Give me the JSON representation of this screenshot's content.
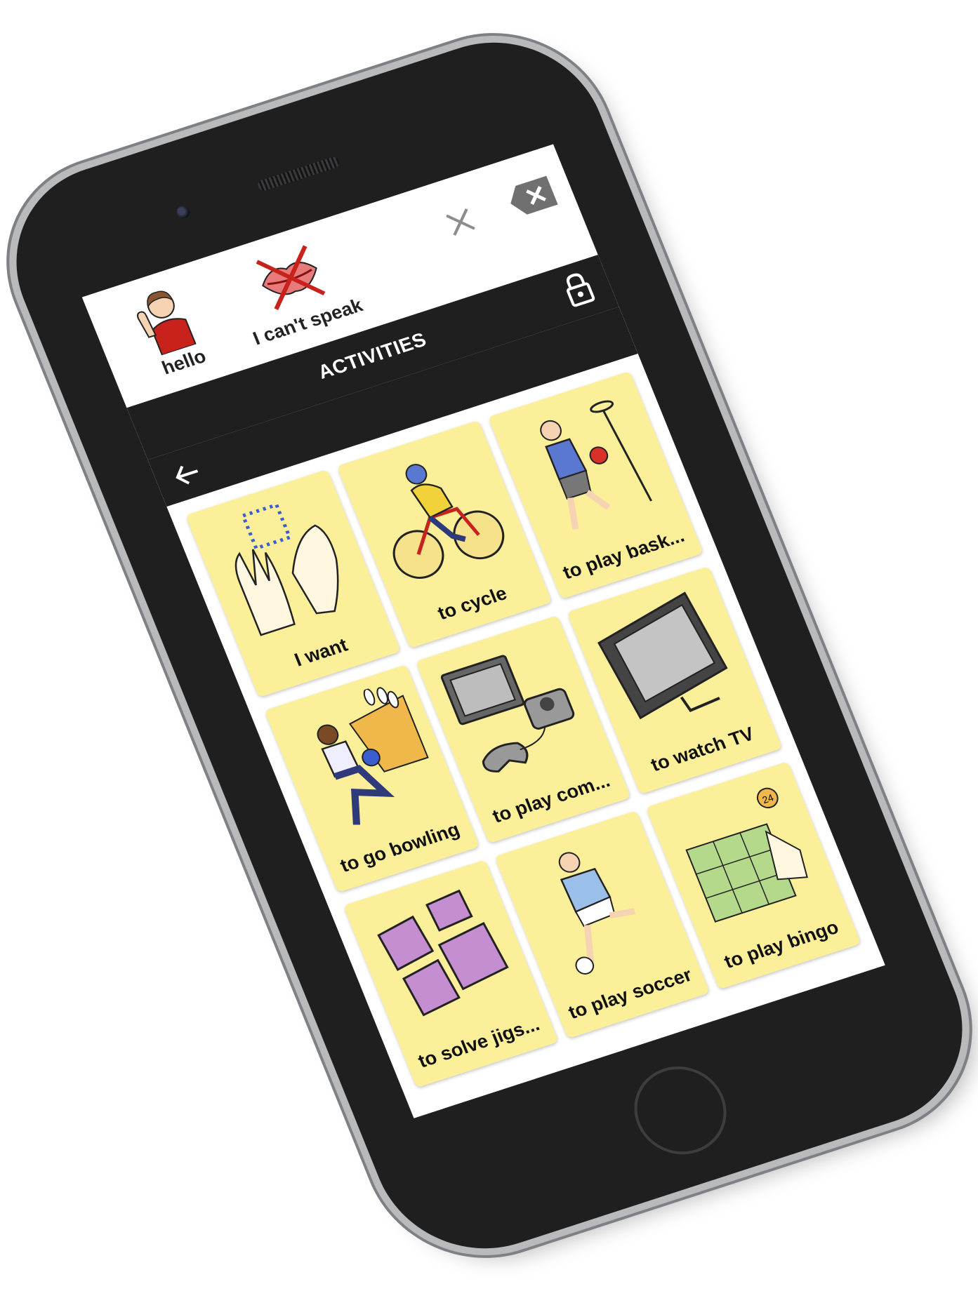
{
  "message_bar": {
    "items": [
      {
        "label": "hello",
        "icon": "waving-person-icon"
      },
      {
        "label": "I can't speak",
        "icon": "crossed-lips-icon"
      }
    ],
    "clear_icon": "close-icon",
    "backspace_icon": "backspace-icon"
  },
  "board": {
    "title": "ACTIVITIES",
    "lock_icon": "lock-icon",
    "back_icon": "arrow-left-icon",
    "tiles": [
      {
        "label": "I want",
        "icon": "hands-want-icon"
      },
      {
        "label": "to cycle",
        "icon": "cyclist-icon"
      },
      {
        "label": "to play bask...",
        "icon": "basketball-player-icon"
      },
      {
        "label": "to go bowling",
        "icon": "bowling-icon"
      },
      {
        "label": "to play com...",
        "icon": "game-console-icon"
      },
      {
        "label": "to watch TV",
        "icon": "tv-icon"
      },
      {
        "label": "to solve jigs...",
        "icon": "jigsaw-puzzle-icon"
      },
      {
        "label": "to play soccer",
        "icon": "soccer-player-icon"
      },
      {
        "label": "to play bingo",
        "icon": "bingo-card-icon"
      }
    ]
  },
  "colors": {
    "tile_background": "#fbef9a",
    "bar_background": "#1f1f20",
    "phone_body": "#1f1f20"
  }
}
